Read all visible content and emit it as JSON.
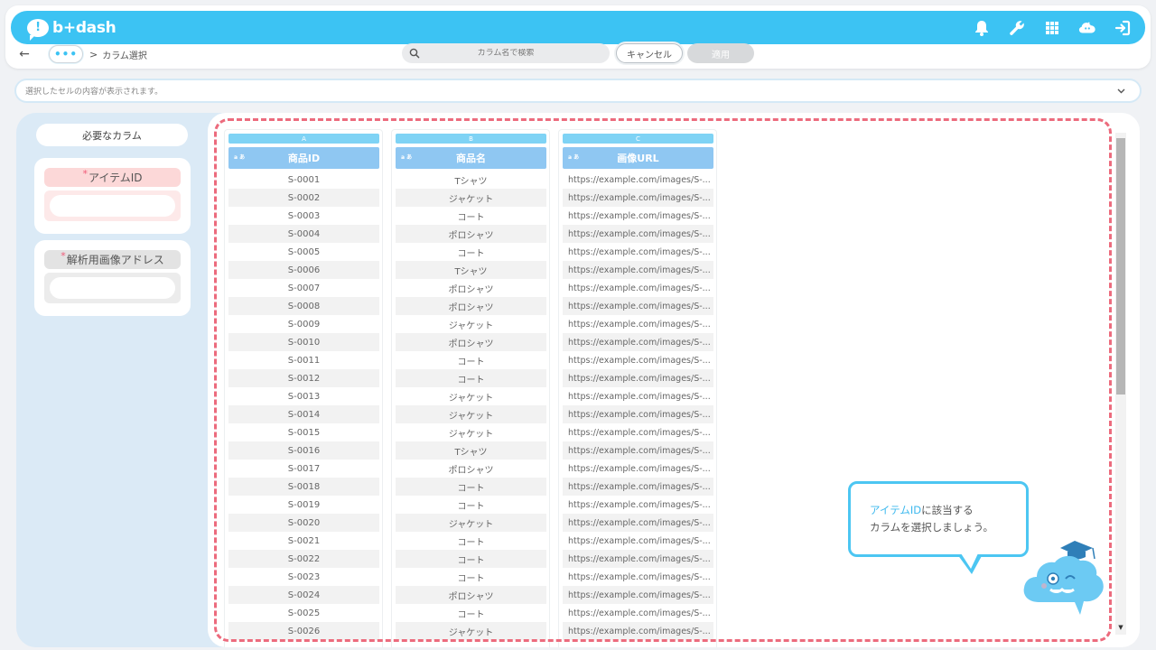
{
  "header": {
    "logo_mark": "!",
    "logo_text": "b+dash",
    "icons": [
      "bell-icon",
      "wrench-icon",
      "apps-grid-icon",
      "cloud-face-icon",
      "logout-icon"
    ]
  },
  "subbar": {
    "more": "•••",
    "separator": ">",
    "breadcrumb": "カラム選択",
    "search_placeholder": "カラム名で検索",
    "cancel_label": "キャンセル",
    "apply_label": "適用"
  },
  "cellbar": {
    "text": "選択したセルの内容が表示されます。"
  },
  "left_panel": {
    "required_label": "必要なカラム",
    "slots": [
      {
        "star": "*",
        "title": "アイテムID"
      },
      {
        "star": "*",
        "title": "解析用画像アドレス"
      }
    ]
  },
  "table": {
    "columns": [
      {
        "letter": "A",
        "type": "a あ",
        "name": "商品ID"
      },
      {
        "letter": "B",
        "type": "a あ",
        "name": "商品名"
      },
      {
        "letter": "C",
        "type": "a あ",
        "name": "画像URL"
      }
    ],
    "ids": [
      "S-0001",
      "S-0002",
      "S-0003",
      "S-0004",
      "S-0005",
      "S-0006",
      "S-0007",
      "S-0008",
      "S-0009",
      "S-0010",
      "S-0011",
      "S-0012",
      "S-0013",
      "S-0014",
      "S-0015",
      "S-0016",
      "S-0017",
      "S-0018",
      "S-0019",
      "S-0020",
      "S-0021",
      "S-0022",
      "S-0023",
      "S-0024",
      "S-0025",
      "S-0026"
    ],
    "names": [
      "Tシャツ",
      "ジャケット",
      "コート",
      "ポロシャツ",
      "コート",
      "Tシャツ",
      "ポロシャツ",
      "ポロシャツ",
      "ジャケット",
      "ポロシャツ",
      "コート",
      "コート",
      "ジャケット",
      "ジャケット",
      "ジャケット",
      "Tシャツ",
      "ポロシャツ",
      "コート",
      "コート",
      "ジャケット",
      "コート",
      "コート",
      "コート",
      "ポロシャツ",
      "コート",
      "ジャケット"
    ],
    "url_text": "https://example.com/images/S-..."
  },
  "hint": {
    "highlight": "アイテムID",
    "line1_rest": "に該当する",
    "line2": "カラムを選択しましょう。"
  },
  "colors": {
    "brand": "#3cc3f3",
    "dash": "#ec6b7d",
    "header_col": "#8fc7f2"
  }
}
